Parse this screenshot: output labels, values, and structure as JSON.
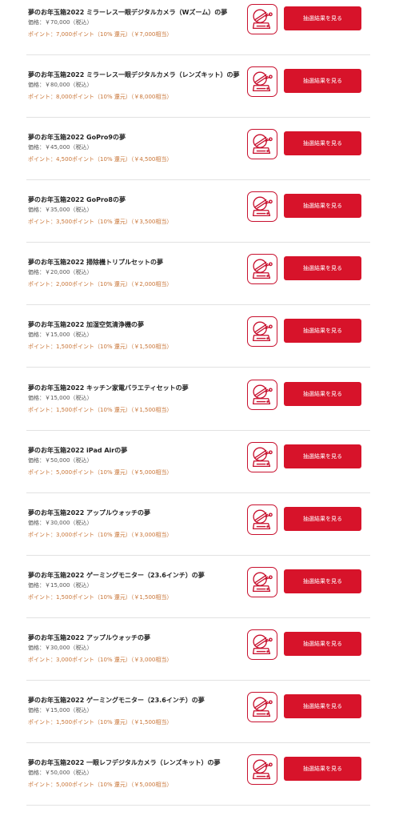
{
  "items": [
    {
      "title": "夢のお年玉箱2022 ミラーレス一眼デジタルカメラ（Wズーム）の夢",
      "price": "価格：￥70,000（税込）",
      "points": "ポイント：7,000ポイント（10% 還元）（￥7,000相当）",
      "button": "抽選結果を見る"
    },
    {
      "title": "夢のお年玉箱2022 ミラーレス一眼デジタルカメラ（レンズキット）の夢",
      "price": "価格：￥80,000（税込）",
      "points": "ポイント：8,000ポイント（10% 還元）（￥8,000相当）",
      "button": "抽選結果を見る"
    },
    {
      "title": "夢のお年玉箱2022 GoPro9の夢",
      "price": "価格：￥45,000（税込）",
      "points": "ポイント：4,500ポイント（10% 還元）（￥4,500相当）",
      "button": "抽選結果を見る"
    },
    {
      "title": "夢のお年玉箱2022 GoPro8の夢",
      "price": "価格：￥35,000（税込）",
      "points": "ポイント：3,500ポイント（10% 還元）（￥3,500相当）",
      "button": "抽選結果を見る"
    },
    {
      "title": "夢のお年玉箱2022 掃除機トリプルセットの夢",
      "price": "価格：￥20,000（税込）",
      "points": "ポイント：2,000ポイント（10% 還元）（￥2,000相当）",
      "button": "抽選結果を見る"
    },
    {
      "title": "夢のお年玉箱2022 加湿空気清浄機の夢",
      "price": "価格：￥15,000（税込）",
      "points": "ポイント：1,500ポイント（10% 還元）（￥1,500相当）",
      "button": "抽選結果を見る"
    },
    {
      "title": "夢のお年玉箱2022 キッチン家電バラエティセットの夢",
      "price": "価格：￥15,000（税込）",
      "points": "ポイント：1,500ポイント（10% 還元）（￥1,500相当）",
      "button": "抽選結果を見る"
    },
    {
      "title": "夢のお年玉箱2022 iPad Airの夢",
      "price": "価格：￥50,000（税込）",
      "points": "ポイント：5,000ポイント（10% 還元）（￥5,000相当）",
      "button": "抽選結果を見る"
    },
    {
      "title": "夢のお年玉箱2022 アップルウォッチの夢",
      "price": "価格：￥30,000（税込）",
      "points": "ポイント：3,000ポイント（10% 還元）（￥3,000相当）",
      "button": "抽選結果を見る"
    },
    {
      "title": "夢のお年玉箱2022 ゲーミングモニター（23.6インチ）の夢",
      "price": "価格：￥15,000（税込）",
      "points": "ポイント：1,500ポイント（10% 還元）（￥1,500相当）",
      "button": "抽選結果を見る"
    },
    {
      "title": "夢のお年玉箱2022 アップルウォッチの夢",
      "price": "価格：￥30,000（税込）",
      "points": "ポイント：3,000ポイント（10% 還元）（￥3,000相当）",
      "button": "抽選結果を見る"
    },
    {
      "title": "夢のお年玉箱2022 ゲーミングモニター（23.6インチ）の夢",
      "price": "価格：￥15,000（税込）",
      "points": "ポイント：1,500ポイント（10% 還元）（￥1,500相当）",
      "button": "抽選結果を見る"
    },
    {
      "title": "夢のお年玉箱2022 一眼レフデジタルカメラ（レンズキット）の夢",
      "price": "価格：￥50,000（税込）",
      "points": "ポイント：5,000ポイント（10% 還元）（￥5,000相当）",
      "button": "抽選結果を見る"
    }
  ],
  "colors": {
    "button_bg": "#d7132a",
    "stamp_red": "#c8102e",
    "points_text": "#c87436",
    "divider": "#e2e2e2"
  },
  "icons": {
    "lottery": "lottery-machine-icon"
  }
}
